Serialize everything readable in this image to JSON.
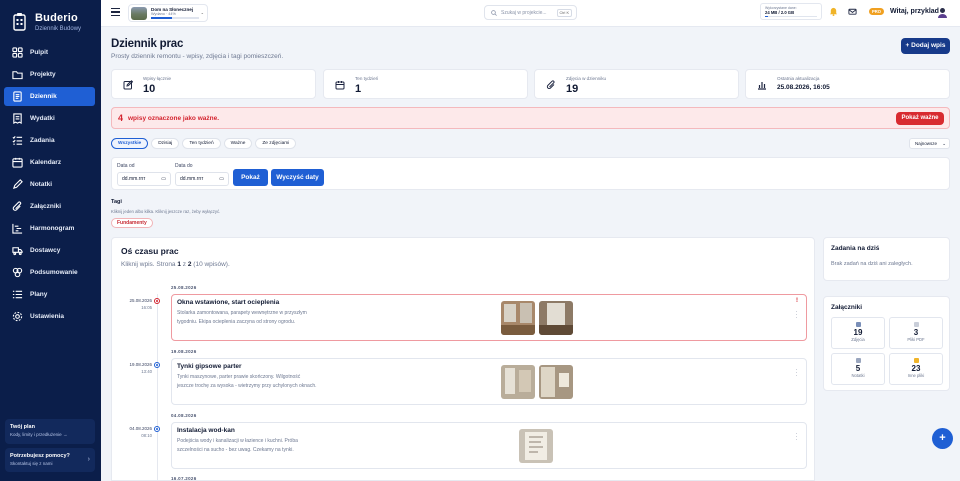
{
  "brand": {
    "name": "Buderio",
    "subtitle": "Dziennik Budowy"
  },
  "nav": [
    {
      "label": "Pulpit",
      "icon": "grid-icon",
      "active": false
    },
    {
      "label": "Projekty",
      "icon": "folder-icon",
      "active": false
    },
    {
      "label": "Dziennik",
      "icon": "book-icon",
      "active": true
    },
    {
      "label": "Wydatki",
      "icon": "receipt-icon",
      "active": false
    },
    {
      "label": "Zadania",
      "icon": "checklist-icon",
      "active": false
    },
    {
      "label": "Kalendarz",
      "icon": "calendar-icon",
      "active": false
    },
    {
      "label": "Notatki",
      "icon": "pencil-icon",
      "active": false
    },
    {
      "label": "Załączniki",
      "icon": "paperclip-icon",
      "active": false
    },
    {
      "label": "Harmonogram",
      "icon": "gantt-icon",
      "active": false
    },
    {
      "label": "Dostawcy",
      "icon": "truck-icon",
      "active": false
    },
    {
      "label": "Podsumowanie",
      "icon": "chart-icon",
      "active": false
    },
    {
      "label": "Plany",
      "icon": "list-icon",
      "active": false
    },
    {
      "label": "Ustawienia",
      "icon": "gear-icon",
      "active": false
    }
  ],
  "plan_box": {
    "title": "Twój plan",
    "subtitle": "Kody, limity i przedłużenie →"
  },
  "help_box": {
    "title": "Potrzebujesz pomocy?",
    "subtitle": "Skontaktuj się z nami",
    "chevron": "›"
  },
  "topbar": {
    "project_name": "Dom na Słonecznej",
    "project_progress_label": "Wydano · 44%",
    "project_progress": 0.44,
    "search_placeholder": "Szukaj w projekcie...",
    "search_shortcut": "Ctrl K",
    "storage_label": "Wykorzystane dane:",
    "storage_value": "24 MB / 2.0 GB",
    "storage_fraction": 0.012,
    "pro_badge": "PRO",
    "greeting": "Witaj, przyklad"
  },
  "page": {
    "title": "Dziennik prac",
    "subtitle": "Prosty dziennik remontu - wpisy, zdjęcia i tagi pomieszczeń.",
    "add_button": "+ Dodaj wpis"
  },
  "stats": [
    {
      "label": "Wpisy łącznie",
      "value": "10",
      "icon": "edit-icon"
    },
    {
      "label": "Ten tydzień",
      "value": "1",
      "icon": "calendar-icon"
    },
    {
      "label": "Zdjęcia w dzienniku",
      "value": "19",
      "icon": "paperclip-icon"
    },
    {
      "label": "Ostatnia aktualizacja",
      "value": "25.08.2026, 16:05",
      "icon": "bar-chart-icon"
    }
  ],
  "alert": {
    "count": "4",
    "text": "wpisy oznaczone jako ważne.",
    "button": "Pokaż ważne"
  },
  "filters": {
    "tabs": [
      "Wszystkie",
      "Dzisiaj",
      "Ten tydzień",
      "Ważne",
      "Ze zdjęciami"
    ],
    "active": 0,
    "sort_value": "Najnowsze",
    "sort_chevron": "⌄"
  },
  "dates": {
    "from_label": "Data od",
    "to_label": "Data do",
    "placeholder": "dd.mm.rrrr",
    "show_button": "Pokaż",
    "clear_button": "Wyczyść daty",
    "calendar_glyph": "▭"
  },
  "tags": {
    "title": "Tagi",
    "hint": "Kliknij jeden albo kilka. Kliknij jeszcze raz, żeby wyłączyć.",
    "items": [
      "Fundamenty"
    ]
  },
  "timeline": {
    "title": "Oś czasu prac",
    "sub_prefix": "Kliknij wpis. Strona ",
    "page_current": "1",
    "sub_mid": " z ",
    "page_total": "2",
    "sub_suffix": " (10 wpisów).",
    "days": [
      "25.08.2026",
      "19.08.2026",
      "04.08.2026",
      "16.07.2026"
    ],
    "entries": [
      {
        "date": "25.08.2026",
        "time": "16:05",
        "title": "Okna wstawione, start ocieplenia",
        "desc": "Stolarka zamontowana, parapety wewnętrzne w przyszłym tygodniu. Ekipa ocieplenia zaczyna od strony ogrodu.",
        "important": true,
        "flag": "!"
      },
      {
        "date": "19.08.2026",
        "time": "13:40",
        "title": "Tynki gipsowe parter",
        "desc": "Tynki maszynowe, parter prawie skończony. Wilgotność jeszcze trochę za wysoka - wietrzymy przy uchylonych oknach.",
        "important": false
      },
      {
        "date": "04.08.2026",
        "time": "08:10",
        "title": "Instalacja wod-kan",
        "desc": "Podejścia wody i kanalizacji w łazience i kuchni. Próba szczelności na sucho - bez uwag. Czekamy na tynki.",
        "important": false
      }
    ]
  },
  "tasks_today": {
    "title": "Zadania na dziś",
    "empty": "Brak zadań na dziś ani zaległych."
  },
  "attachments": {
    "title": "Załączniki",
    "items": [
      {
        "value": "19",
        "label": "Zdjęcia",
        "color": "#7a8fb8"
      },
      {
        "value": "3",
        "label": "Pliki PDF",
        "color": "#c9ced9"
      },
      {
        "value": "5",
        "label": "Notatki",
        "color": "#9aa6be"
      },
      {
        "value": "23",
        "label": "Inne pliki",
        "color": "#f0b429"
      }
    ]
  },
  "fab": "+"
}
